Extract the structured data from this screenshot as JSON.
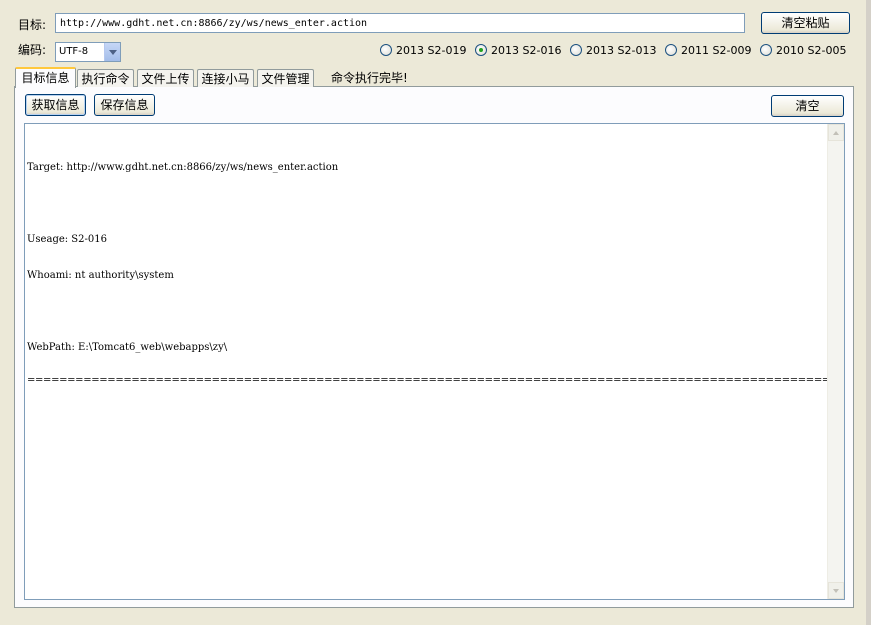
{
  "target": {
    "label": "目标:",
    "url": "http://www.gdht.net.cn:8866/zy/ws/news_enter.action",
    "clear_paste_label": "清空粘贴"
  },
  "encoding": {
    "label": "编码:",
    "value": "UTF-8"
  },
  "exploits": [
    {
      "label": "2013 S2-019",
      "checked": false
    },
    {
      "label": "2013 S2-016",
      "checked": true
    },
    {
      "label": "2013 S2-013",
      "checked": false
    },
    {
      "label": "2011 S2-009",
      "checked": false
    },
    {
      "label": "2010 S2-005",
      "checked": false
    }
  ],
  "tabs": [
    {
      "label": "目标信息",
      "active": true
    },
    {
      "label": "执行命令",
      "active": false
    },
    {
      "label": "文件上传",
      "active": false
    },
    {
      "label": "连接小马",
      "active": false
    },
    {
      "label": "文件管理",
      "active": false
    }
  ],
  "status": "命令执行完毕!",
  "toolbar": {
    "get_info_label": "获取信息",
    "save_info_label": "保存信息",
    "clear_label": "清空"
  },
  "output": {
    "lines": [
      "Target: http://www.gdht.net.cn:8866/zy/ws/news_enter.action",
      "",
      "Useage: S2-016",
      "Whoami: nt authority\\system",
      "",
      "WebPath: E:\\Tomcat6_web\\webapps\\zy\\",
      "========================================================================================================================"
    ]
  }
}
